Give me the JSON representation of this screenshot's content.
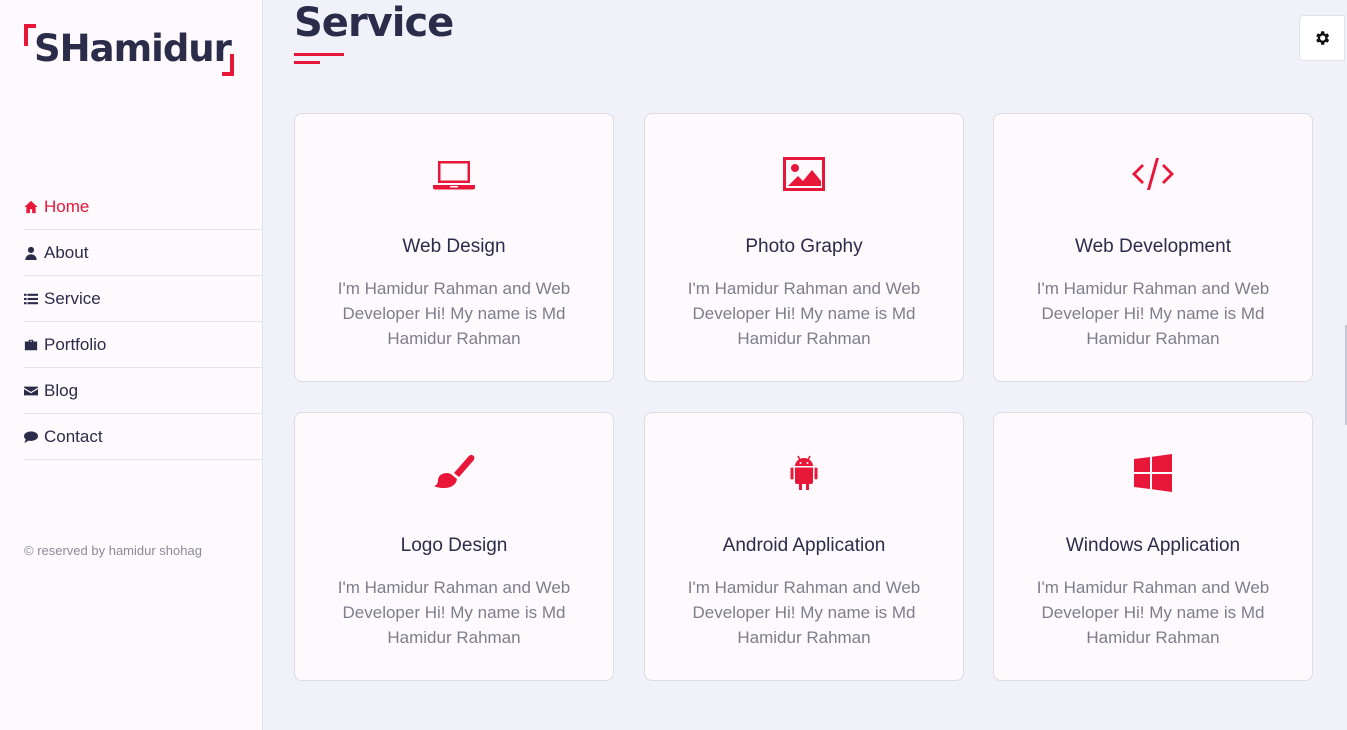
{
  "brand": {
    "logo_text": "SHamidur",
    "accent": "#e8173a",
    "dark": "#2b2c4a"
  },
  "sidebar": {
    "items": [
      {
        "label": "Home",
        "icon": "home-icon",
        "active": true
      },
      {
        "label": "About",
        "icon": "user-icon",
        "active": false
      },
      {
        "label": "Service",
        "icon": "list-icon",
        "active": false
      },
      {
        "label": "Portfolio",
        "icon": "briefcase-icon",
        "active": false
      },
      {
        "label": "Blog",
        "icon": "envelope-icon",
        "active": false
      },
      {
        "label": "Contact",
        "icon": "comment-icon",
        "active": false
      }
    ],
    "copyright": "© reserved by hamidur shohag"
  },
  "main": {
    "title": "Service",
    "settings_icon": "gear-icon",
    "services": [
      {
        "title": "Web Design",
        "icon": "laptop-icon",
        "description": "I'm Hamidur Rahman and Web Developer Hi! My name is Md Hamidur Rahman"
      },
      {
        "title": "Photo Graphy",
        "icon": "image-icon",
        "description": "I'm Hamidur Rahman and Web Developer Hi! My name is Md Hamidur Rahman"
      },
      {
        "title": "Web Development",
        "icon": "code-icon",
        "description": "I'm Hamidur Rahman and Web Developer Hi! My name is Md Hamidur Rahman"
      },
      {
        "title": "Logo Design",
        "icon": "paint-brush-icon",
        "description": "I'm Hamidur Rahman and Web Developer Hi! My name is Md Hamidur Rahman"
      },
      {
        "title": "Android Application",
        "icon": "android-icon",
        "description": "I'm Hamidur Rahman and Web Developer Hi! My name is Md Hamidur Rahman"
      },
      {
        "title": "Windows Application",
        "icon": "windows-icon",
        "description": "I'm Hamidur Rahman and Web Developer Hi! My name is Md Hamidur Rahman"
      }
    ]
  }
}
